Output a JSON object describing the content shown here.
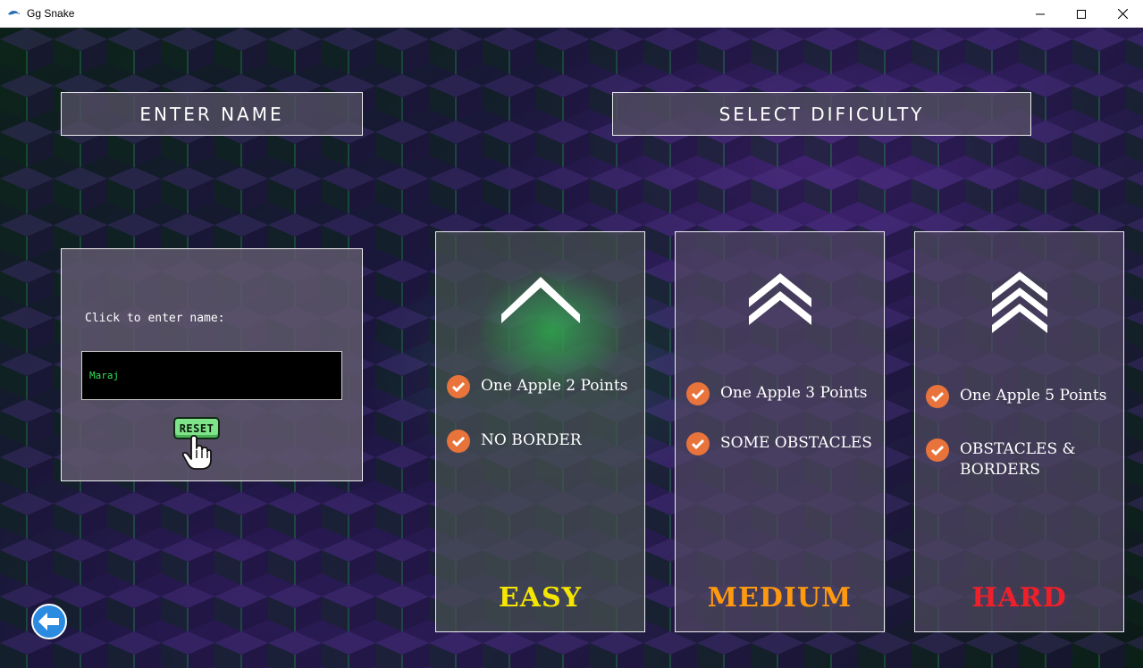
{
  "window": {
    "title": "Gg Snake",
    "controls": [
      "minimize-icon",
      "maximize-icon",
      "close-icon"
    ]
  },
  "header": {
    "enter_name": "ENTER NAME",
    "select_difficulty": "SELECT DIFICULTY"
  },
  "name_panel": {
    "prompt": "Click to enter name:",
    "input_value": "Maraj",
    "reset_label": "RESET"
  },
  "difficulties": [
    {
      "label": "EASY",
      "color": "#f4e600",
      "chevrons": 1,
      "features": [
        "One Apple 2 Points",
        "NO BORDER"
      ]
    },
    {
      "label": "MEDIUM",
      "color": "#ff9a10",
      "chevrons": 2,
      "features": [
        "One Apple 3 Points",
        "SOME OBSTACLES"
      ]
    },
    {
      "label": "HARD",
      "color": "#f0202a",
      "chevrons": 3,
      "features": [
        "One Apple 5 Points",
        "OBSTACLES & BORDERS"
      ]
    }
  ],
  "back_button": {
    "icon": "back-arrow-icon"
  }
}
